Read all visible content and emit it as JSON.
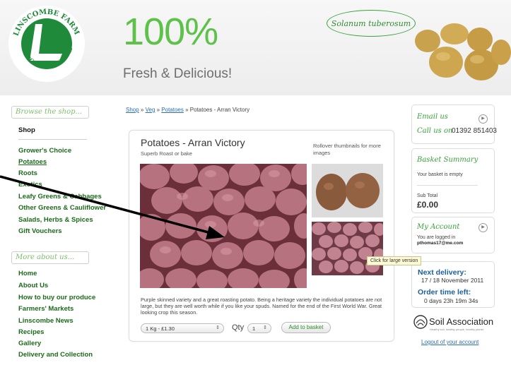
{
  "header": {
    "logo_text_top": "LINSCOMBE FARM",
    "logo_text_bottom": "ORGANIC VEGETABLES",
    "hero_percent": "100%",
    "hero_subtitle": "Fresh & Delicious!",
    "latin_name": "Solanum tuberosum"
  },
  "nav": {
    "browse_label": "Browse the shop...",
    "shop_heading": "Shop",
    "shop_items": [
      {
        "label": "Grower's Choice"
      },
      {
        "label": "Potatoes"
      },
      {
        "label": "Roots"
      },
      {
        "label": "Exotics"
      },
      {
        "label": "Leafy Greens & Cabbages"
      },
      {
        "label": "Other Greens & Cauliflower"
      },
      {
        "label": "Salads, Herbs & Spices"
      },
      {
        "label": "Gift Vouchers"
      }
    ],
    "more_label": "More about us...",
    "more_items": [
      {
        "label": "Home"
      },
      {
        "label": "About Us"
      },
      {
        "label": "How to buy our produce"
      },
      {
        "label": "Farmers' Markets"
      },
      {
        "label": "Linscombe News"
      },
      {
        "label": "Recipes"
      },
      {
        "label": "Gallery"
      },
      {
        "label": "Delivery and Collection"
      }
    ]
  },
  "breadcrumb": {
    "shop": "Shop",
    "sep": " » ",
    "veg": "Veg",
    "potatoes": "Potatoes",
    "current": "Potatoes - Arran Victory"
  },
  "product": {
    "title": "Potatoes - Arran Victory",
    "subtitle": "Superb Roast or bake",
    "rollover_hint": "Rollover thumbnails for more images",
    "description": "Purple skinned variety and a great roasting potato. Being a heritage variety the individual potatoes are not large, but they are well worth while if you like your spuds. Named for the end of the First World War. Great looking crop this season.",
    "weight_option": "1 Kg - £1.30",
    "qty_label": "Qty",
    "qty_value": "1",
    "add_button": "Add to basket",
    "tooltip": "Click for large version"
  },
  "contact": {
    "email_us": "Email us",
    "call_us": "Call us on",
    "phone": "01392 851403"
  },
  "basket": {
    "title": "Basket Summary",
    "empty_text": "Your basket is empty",
    "subtotal_label": "Sub Total",
    "subtotal_value": "£0.00"
  },
  "account": {
    "title": "My Account",
    "logged_in_text": "You are logged in",
    "email": "pthomas17@me.com",
    "logout": "Logout of your account"
  },
  "delivery": {
    "next_label": "Next delivery:",
    "next_value": "17 / 18 November 2011",
    "order_label": "Order time left:",
    "order_value": "0 days 23h 19m 34s"
  },
  "soil": {
    "name": "Soil Association",
    "tagline": "Healthy soil, healthy people, healthy planet"
  },
  "colors": {
    "brand_green": "#5ec24a",
    "logo_green": "#1f8a3a",
    "link_blue": "#2a6fb5",
    "heading_blue": "#1a5f9e",
    "nav_green": "#1a6b1a"
  }
}
